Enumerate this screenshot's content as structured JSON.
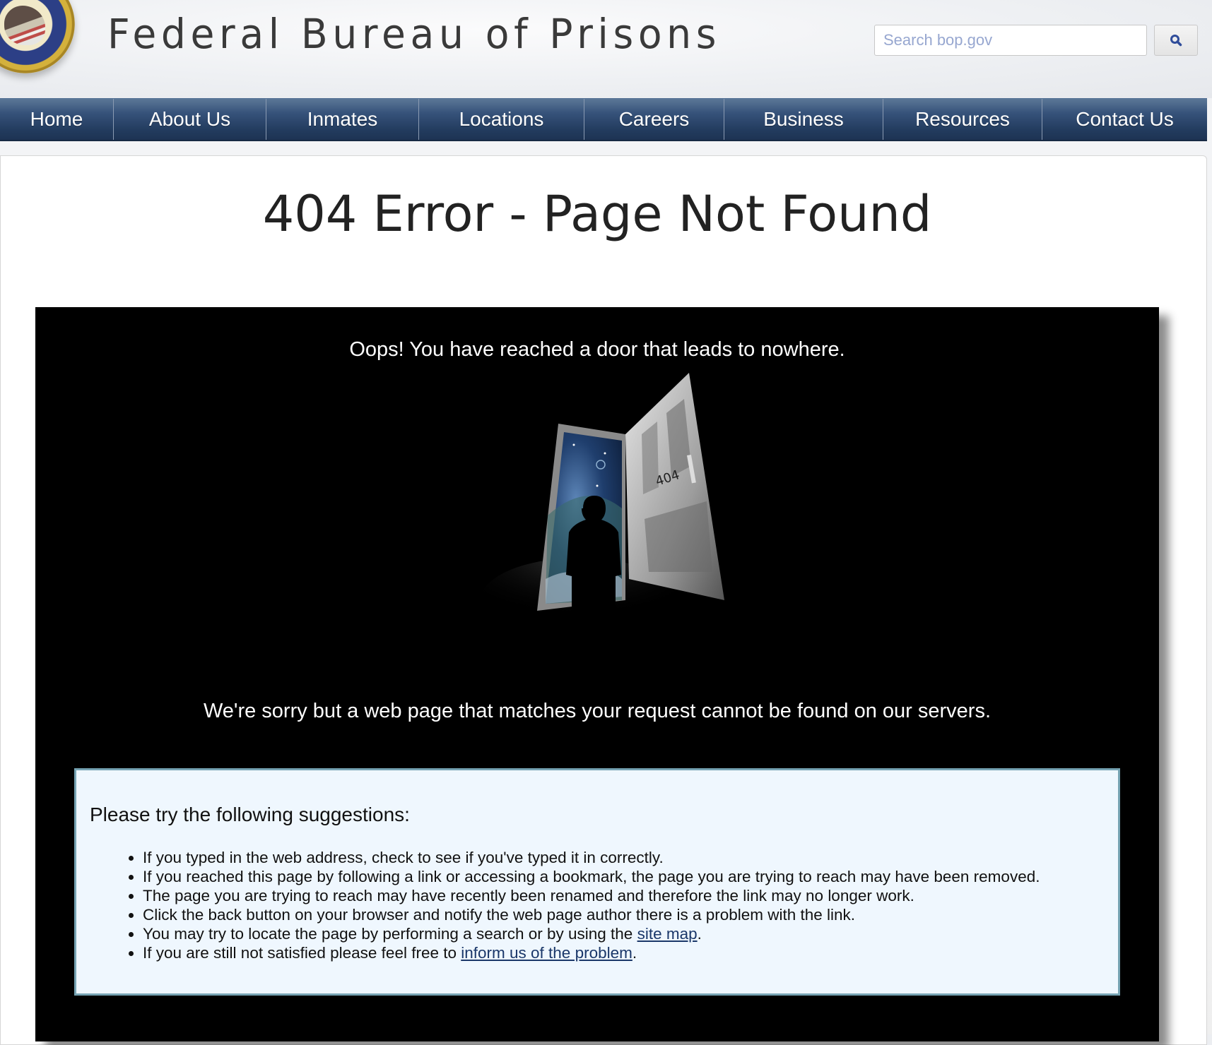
{
  "header": {
    "site_title": "Federal Bureau of Prisons",
    "logo": "department-of-justice-bureau-of-prisons-seal",
    "search": {
      "placeholder": "Search bop.gov",
      "value": "",
      "button_icon": "search-icon"
    }
  },
  "nav": {
    "items": [
      {
        "label": "Home"
      },
      {
        "label": "About Us"
      },
      {
        "label": "Inmates"
      },
      {
        "label": "Locations"
      },
      {
        "label": "Careers"
      },
      {
        "label": "Business"
      },
      {
        "label": "Resources"
      },
      {
        "label": "Contact Us"
      }
    ]
  },
  "main": {
    "title": "404 Error - Page Not Found",
    "oops_text": "Oops! You have reached a door that leads to nowhere.",
    "illustration": {
      "description": "silhouette-at-open-door-to-space",
      "door_number": "404"
    },
    "sorry_text": "We're sorry but a web page that matches your request cannot be found on our servers.",
    "suggestions": {
      "heading": "Please try the following suggestions:",
      "items": [
        {
          "text": "If you typed in the web address, check to see if you've typed it in correctly."
        },
        {
          "text": "If you reached this page by following a link or accessing a bookmark, the page you are trying to reach may have been removed."
        },
        {
          "text": "The page you are trying to reach may have recently been renamed and therefore the link may no longer work."
        },
        {
          "text": "Click the back button on your browser and notify the web page author there is a problem with the link."
        },
        {
          "text": "You may try to locate the page by performing a search or by using the ",
          "link": "site map",
          "after": "."
        },
        {
          "text": "If you are still not satisfied please feel free to ",
          "link": "inform us of the problem",
          "after": "."
        }
      ]
    }
  },
  "colors": {
    "nav_dark": "#1d3353",
    "nav_light": "#5b7797",
    "link": "#1a3769",
    "suggest_bg": "#eff7fe",
    "suggest_border": "#76a3b3",
    "placeholder": "#97a7d0"
  }
}
